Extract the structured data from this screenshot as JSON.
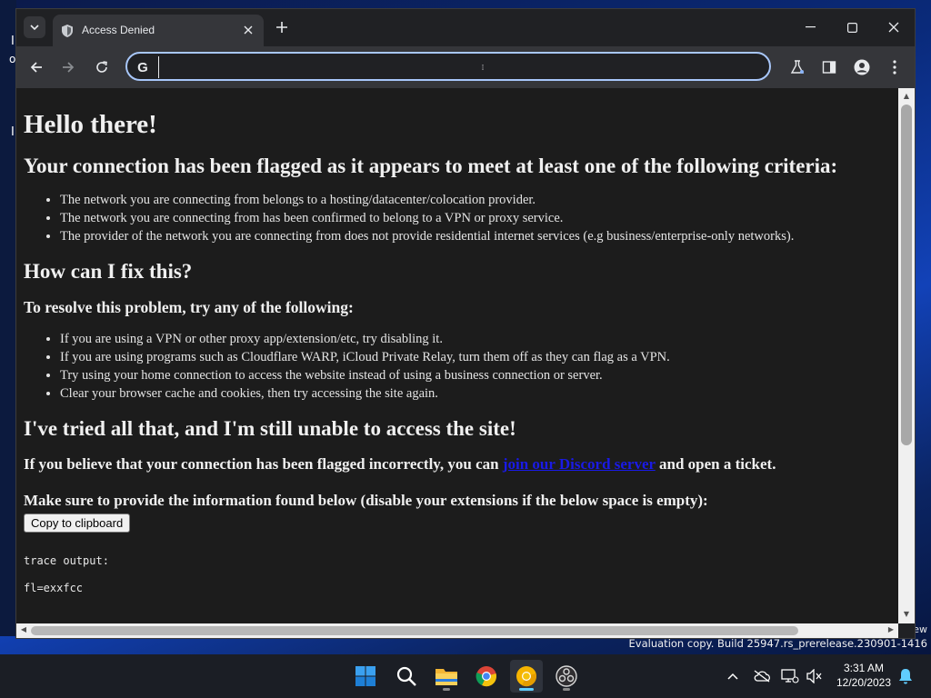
{
  "desktop": {
    "left_glyphs": [
      "I",
      "o",
      "I"
    ],
    "right_text": "ew",
    "evaluation_notice": "Evaluation copy. Build 25947.rs_prerelease.230901-1416"
  },
  "browser": {
    "tab": {
      "title": "Access Denied",
      "favicon": "shield-icon"
    },
    "omnibox": {
      "value": "",
      "placeholder": ""
    },
    "toolbar_icons": [
      "back-icon",
      "forward-icon",
      "reload-icon",
      "labs-icon",
      "side-panel-icon",
      "profile-icon",
      "menu-icon"
    ]
  },
  "page": {
    "heading": "Hello there!",
    "criteria_heading": "Your connection has been flagged as it appears to meet at least one of the following criteria:",
    "criteria": [
      "The network you are connecting from belongs to a hosting/datacenter/colocation provider.",
      "The network you are connecting from has been confirmed to belong to a VPN or proxy service.",
      "The provider of the network you are connecting from does not provide residential internet services (e.g business/enterprise-only networks)."
    ],
    "fix_heading": "How can I fix this?",
    "resolve_heading": "To resolve this problem, try any of the following:",
    "resolve_steps": [
      "If you are using a VPN or other proxy app/extension/etc, try disabling it.",
      "If you are using programs such as Cloudflare WARP, iCloud Private Relay, turn them off as they can flag as a VPN.",
      "Try using your home connection to access the website instead of using a business connection or server.",
      "Clear your browser cache and cookies, then try accessing the site again."
    ],
    "still_heading": "I've tried all that, and I'm still unable to access the site!",
    "flagged_before": "If you believe that your connection has been flagged incorrectly, you can ",
    "flagged_link": "join our Discord server",
    "flagged_after": " and open a ticket.",
    "info_text": "Make sure to provide the information found below (disable your extensions if the below space is empty):",
    "copy_button": "Copy to clipboard",
    "trace_label": "trace output:",
    "trace_cut": "fl=exxfcc"
  },
  "taskbar": {
    "apps": [
      "windows-start-icon",
      "search-icon",
      "file-explorer-icon",
      "chrome-icon",
      "chrome-canary-icon",
      "obs-icon"
    ],
    "clock_time": "3:31 AM",
    "clock_date": "12/20/2023"
  },
  "colors": {
    "page_bg": "#1c1c1c",
    "omnibox_border": "#a8c7fa",
    "link": "#1a1ae6",
    "taskbar_accent": "#60cdff"
  }
}
